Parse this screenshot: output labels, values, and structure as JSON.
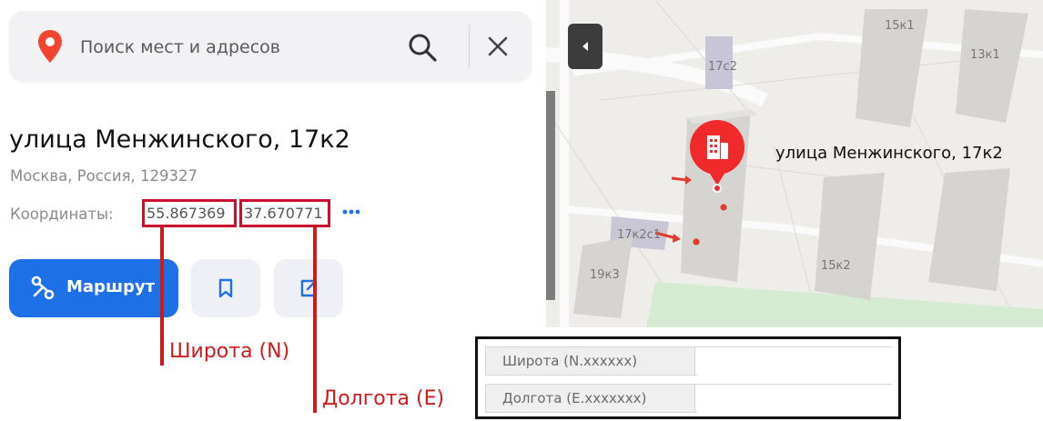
{
  "search": {
    "placeholder": "Поиск мест и адресов",
    "value": ""
  },
  "place": {
    "title": "улица Менжинского, 17к2",
    "subtitle": "Москва, Россия, 129327",
    "coords_label": "Координаты:",
    "latitude": "55.867369",
    "longitude": "37.670771"
  },
  "actions": {
    "route_label": "Маршрут",
    "icons": [
      "route-icon",
      "bookmark-icon",
      "share-icon",
      "more-icon"
    ]
  },
  "annotations": {
    "latitude_label": "Широта (N)",
    "longitude_label": "Долгота (E)",
    "color": "#d01a1a"
  },
  "map": {
    "marker_label": "улица Менжинского, 17к2",
    "buildings": [
      "15к1",
      "13к1",
      "17с2",
      "17к2с1",
      "19к3",
      "15к2"
    ],
    "marker_color": "#f02a2a"
  },
  "form": {
    "latitude_label": "Широта (N.xxxxxx)",
    "longitude_label": "Долгота (E.xxxxxxx)",
    "latitude_value": "",
    "longitude_value": ""
  },
  "colors": {
    "accent": "#1e70e6",
    "search_bg": "#f2f2f5",
    "pin": "#f24430"
  }
}
